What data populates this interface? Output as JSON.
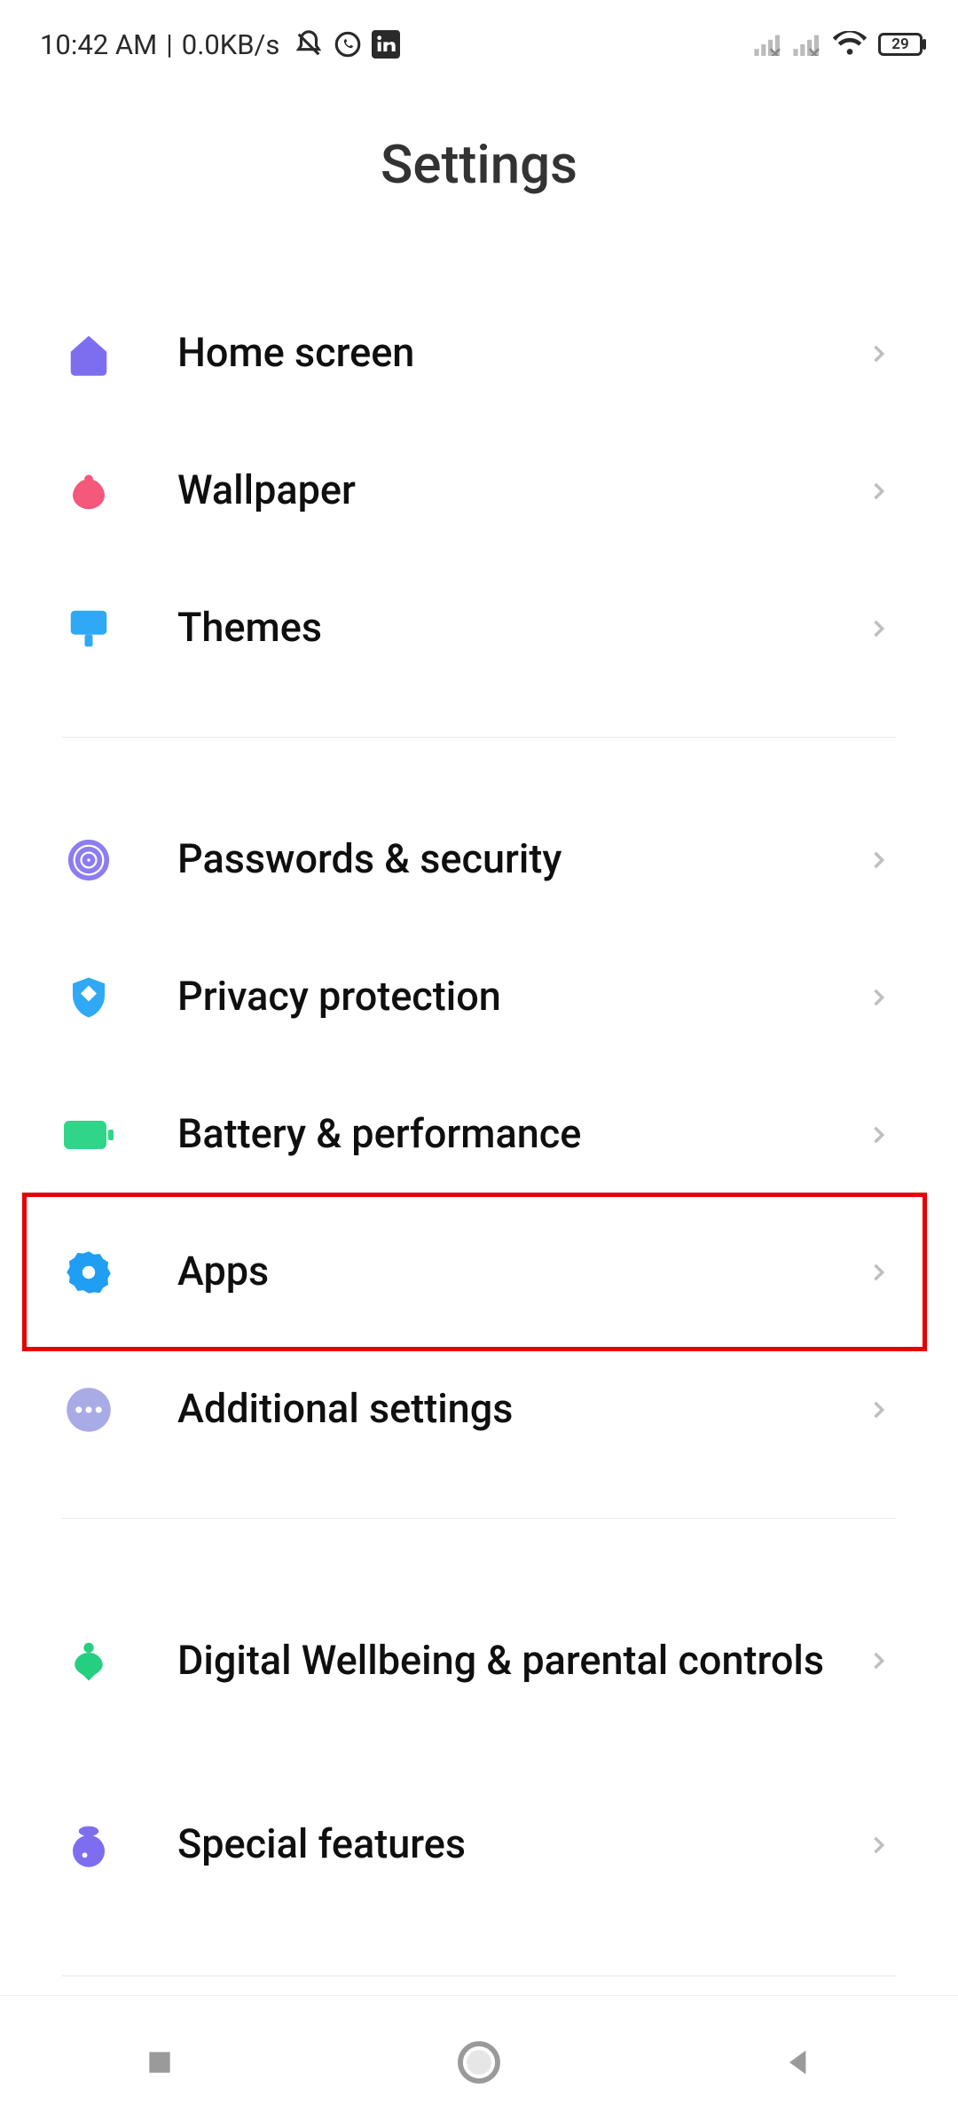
{
  "status": {
    "time": "10:42 AM",
    "separator": " | ",
    "net_speed": "0.0KB/s",
    "battery_pct": "29"
  },
  "title": "Settings",
  "groups": [
    {
      "items": [
        {
          "id": "home-screen",
          "label": "Home screen"
        },
        {
          "id": "wallpaper",
          "label": "Wallpaper"
        },
        {
          "id": "themes",
          "label": "Themes"
        }
      ]
    },
    {
      "items": [
        {
          "id": "passwords-security",
          "label": "Passwords & security"
        },
        {
          "id": "privacy-protection",
          "label": "Privacy protection"
        },
        {
          "id": "battery-performance",
          "label": "Battery & performance"
        },
        {
          "id": "apps",
          "label": "Apps",
          "highlighted": true
        },
        {
          "id": "additional-settings",
          "label": "Additional settings"
        }
      ]
    },
    {
      "items": [
        {
          "id": "digital-wellbeing",
          "label": "Digital Wellbeing & parental controls"
        },
        {
          "id": "special-features",
          "label": "Special features"
        }
      ]
    }
  ]
}
